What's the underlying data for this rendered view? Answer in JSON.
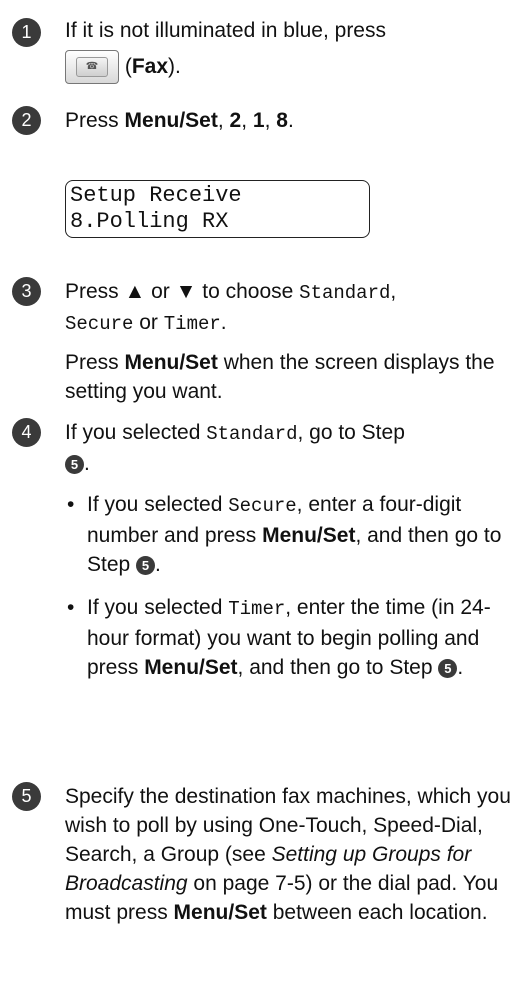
{
  "steps": [
    {
      "number": "1",
      "text_before": "If it is not illuminated in blue, press",
      "key_icon": "fax-key-icon",
      "key_paren_open": "(",
      "key_label": "Fax",
      "key_paren_close": ")."
    },
    {
      "number": "2",
      "press": "Press ",
      "menu_set": "Menu/Set",
      "sep1": ", ",
      "k1": "2",
      "sep2": ", ",
      "k2": "1",
      "sep3": ", ",
      "k3": "8",
      "end": "."
    },
    {
      "number": "3",
      "line_a": "Press ▲ or ▼ to choose ",
      "opt_standard": "Standard",
      "comma": ",",
      "opt_secure": "Secure",
      "or_word": " or ",
      "opt_timer": "Timer",
      "period": ".",
      "line_b_press": "Press ",
      "line_b_menu": "Menu/Set",
      "line_b_rest": " when the screen displays the setting you want."
    },
    {
      "number": "4",
      "intro_a": "If you selected ",
      "intro_opt": "Standard",
      "intro_b": ", go to Step",
      "intro_step": "5",
      "intro_end": ".",
      "bullet_char": "•",
      "bullets": [
        {
          "a": "If you selected ",
          "opt": "Secure",
          "b": ", enter a four-digit number and press ",
          "menu": "Menu/Set",
          "c": ", and then go to Step ",
          "step": "5",
          "end": "."
        },
        {
          "a": "If you selected ",
          "opt": "Timer",
          "b": ", enter the time (in 24-hour format) you want to begin polling and press ",
          "menu": "Menu/Set",
          "c": ", and then go to Step ",
          "step": "5",
          "end": "."
        }
      ]
    },
    {
      "number": "5",
      "t1": "Specify the destination fax machines, which you wish to poll by using One-Touch, Speed-Dial, Search, a Group (see ",
      "italic": "Setting up Groups for Broadcasting",
      "t2": " on page 7-5) or the dial pad. You must press ",
      "menu": "Menu/Set",
      "t3": " between each location."
    }
  ],
  "lcd": {
    "line1": "Setup Receive",
    "line2": "8.Polling RX"
  }
}
